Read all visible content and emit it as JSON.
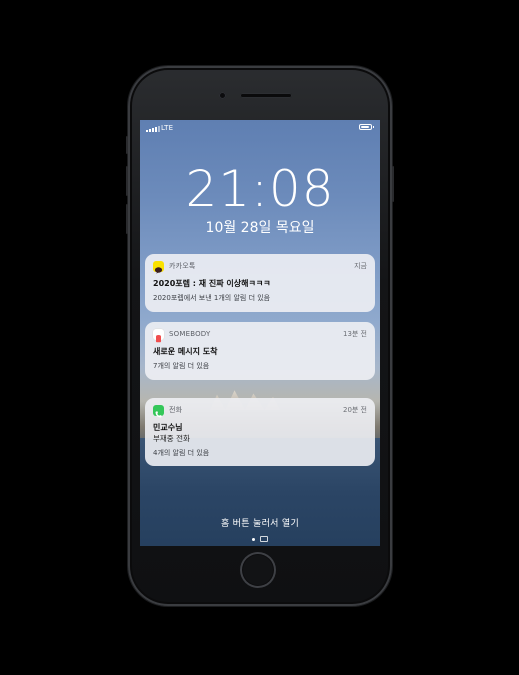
{
  "status_bar": {
    "network": "LTE"
  },
  "lock_screen": {
    "time": "21:08",
    "date": "10월 28일 목요일"
  },
  "notifications": [
    {
      "app": "카카오톡",
      "time": "지금",
      "icon": "kakaotalk-icon",
      "icon_color": "#FAE100",
      "title": "2020포렙 : 재 진짜 이상해ㅋㅋㅋ",
      "more": "2020포렙에서 보낸 1개의 알림 더 있음"
    },
    {
      "app": "SOMEBODY",
      "time": "13분 전",
      "icon": "somebody-icon",
      "icon_color": "#F04E4E",
      "title": "새로운 메시지 도착",
      "more": "7개의 알림 더 있음"
    },
    {
      "app": "전화",
      "time": "20분 전",
      "icon": "phone-icon",
      "icon_color": "#34C759",
      "title": "민교수님",
      "line2": "부재중 전화",
      "more": "4개의 알림 더 있음"
    }
  ],
  "unlock_hint": "홈 버튼 눌러서 열기",
  "colors": {
    "screen_top": "#5f7fb2",
    "sea": "#2c4766",
    "card_bg": "#EEF0F4"
  }
}
